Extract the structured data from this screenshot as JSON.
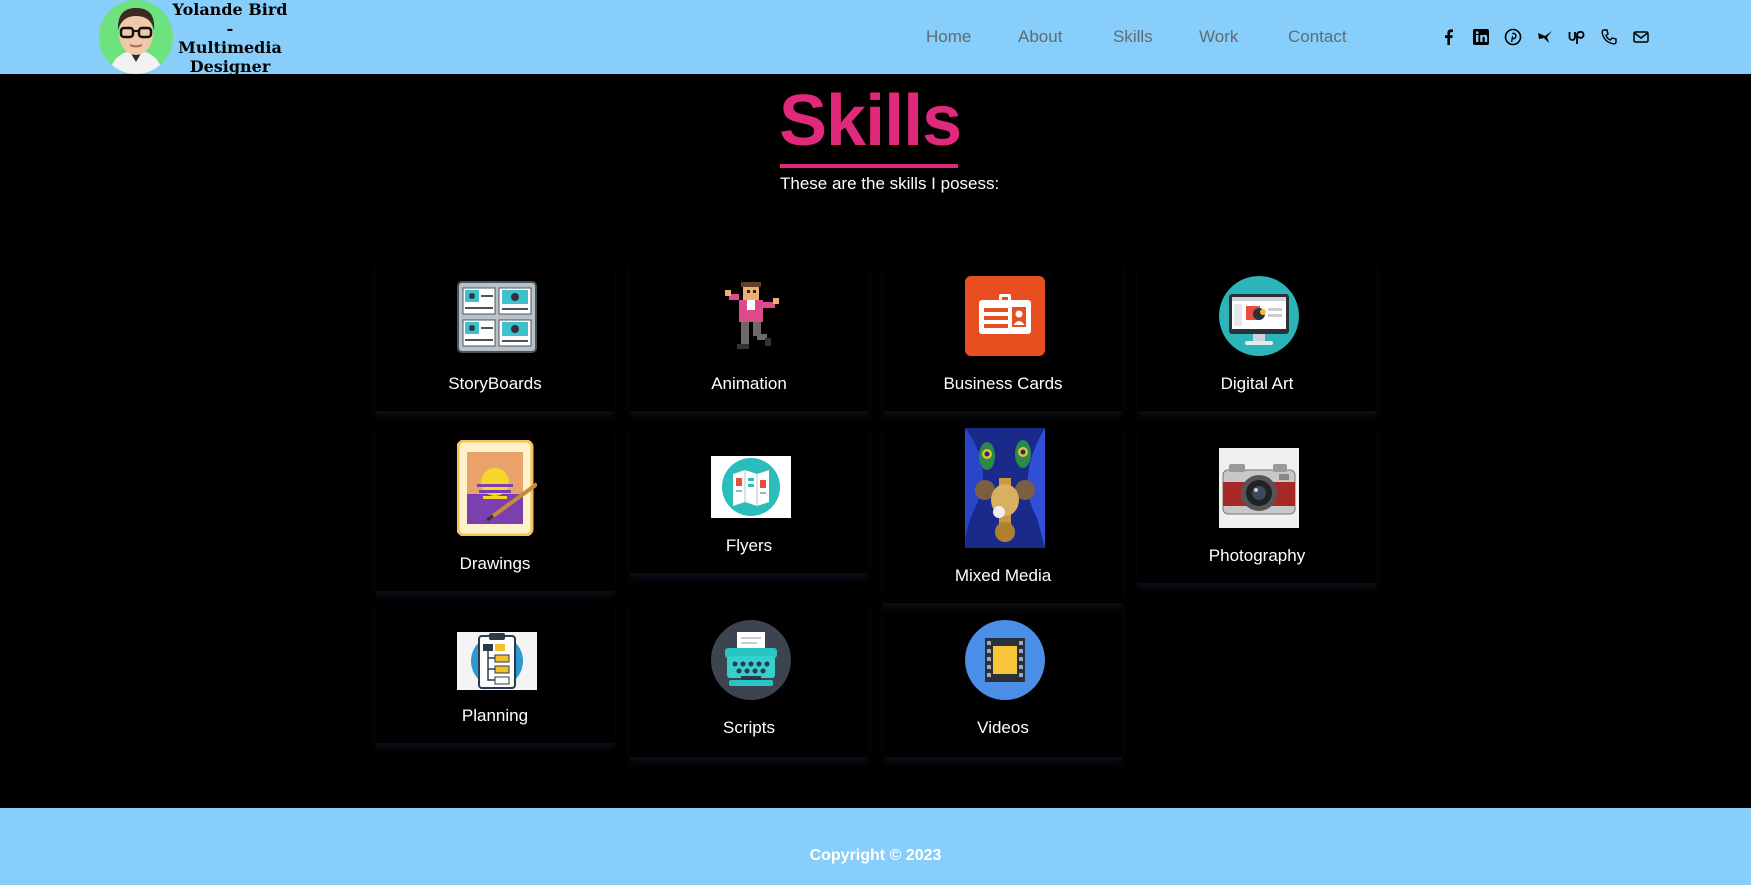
{
  "header": {
    "brand_lines": [
      "Yolande Bird",
      "-",
      "Multimedia",
      "Designer"
    ],
    "nav": [
      "Home",
      "About",
      "Skills",
      "Work",
      "Contact"
    ],
    "socials": [
      "facebook-icon",
      "linkedin-icon",
      "pinterest-icon",
      "fiverr-icon",
      "upwork-icon",
      "phone-icon",
      "email-icon"
    ]
  },
  "main": {
    "title": "Skills",
    "subtitle": "These are the skills I posess:",
    "skills": [
      {
        "label": "StoryBoards",
        "icon": "storyboard-icon"
      },
      {
        "label": "Animation",
        "icon": "animation-icon"
      },
      {
        "label": "Business Cards",
        "icon": "business-card-icon"
      },
      {
        "label": "Digital Art",
        "icon": "digital-art-icon"
      },
      {
        "label": "Drawings",
        "icon": "drawing-icon"
      },
      {
        "label": "Flyers",
        "icon": "flyer-icon"
      },
      {
        "label": "Mixed Media",
        "icon": "mixed-media-icon"
      },
      {
        "label": "Photography",
        "icon": "camera-icon"
      },
      {
        "label": "Planning",
        "icon": "planning-icon"
      },
      {
        "label": "Scripts",
        "icon": "typewriter-icon"
      },
      {
        "label": "Videos",
        "icon": "film-icon"
      }
    ]
  },
  "footer": {
    "copyright": "Copyright © 2023"
  },
  "colors": {
    "header_bg": "#87cefa",
    "accent": "#e0297a",
    "page_bg": "#000000"
  }
}
